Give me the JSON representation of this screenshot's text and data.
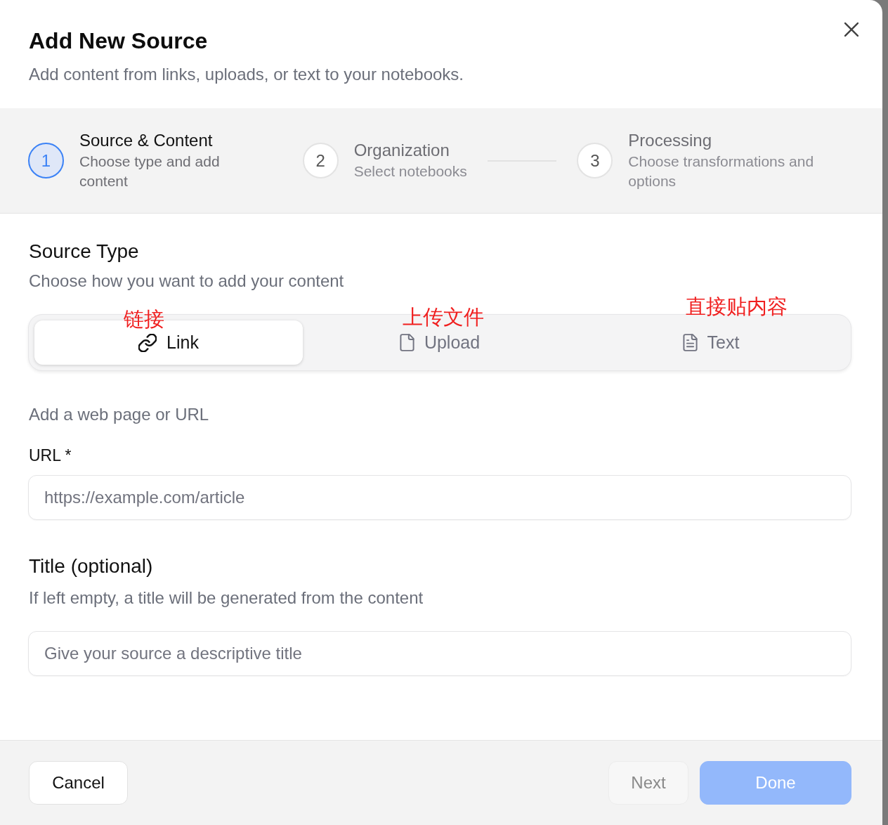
{
  "dialog": {
    "title": "Add New Source",
    "subtitle": "Add content from links, uploads, or text to your notebooks."
  },
  "steps": [
    {
      "number": "1",
      "title": "Source & Content",
      "description": "Choose type and add content",
      "selected": true
    },
    {
      "number": "2",
      "title": "Organization",
      "description": "Select notebooks",
      "selected": false
    },
    {
      "number": "3",
      "title": "Processing",
      "description": "Choose transformations and options",
      "selected": false
    }
  ],
  "section": {
    "title": "Source Type",
    "subtitle": "Choose how you want to add your content"
  },
  "source_types": [
    {
      "kind": "link",
      "label": "Link",
      "annotation": "链接",
      "selected": true
    },
    {
      "kind": "upload",
      "label": "Upload",
      "annotation": "上传文件",
      "selected": false
    },
    {
      "kind": "text",
      "label": "Text",
      "annotation": "直接贴内容",
      "selected": false
    }
  ],
  "description": "Add a web page or URL",
  "url_field": {
    "label": "URL *",
    "placeholder": "https://example.com/article"
  },
  "title_field": {
    "label": "Title (optional)",
    "hint": "If left empty, a title will be generated from the content",
    "placeholder": "Give your source a descriptive title"
  },
  "footer": {
    "cancel": {
      "label": "Cancel",
      "disabled": false
    },
    "actions": [
      {
        "kind": "secondary",
        "label": "Next",
        "disabled": true
      },
      {
        "kind": "primary",
        "label": "Done",
        "disabled": true
      }
    ]
  }
}
